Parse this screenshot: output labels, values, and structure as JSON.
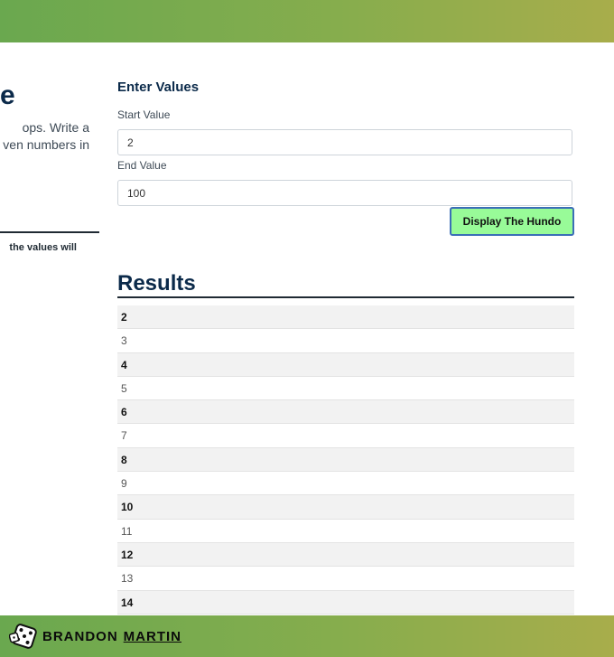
{
  "page": {
    "title_fragment": "e",
    "description_lines": [
      "ops. Write a",
      "ven numbers in"
    ],
    "note_fragment": "the values will"
  },
  "form": {
    "heading": "Enter Values",
    "start_label": "Start Value",
    "start_value": "2",
    "end_label": "End Value",
    "end_value": "100",
    "submit_label": "Display The Hundo"
  },
  "results": {
    "heading": "Results",
    "items": [
      "2",
      "3",
      "4",
      "5",
      "6",
      "7",
      "8",
      "9",
      "10",
      "11",
      "12",
      "13",
      "14"
    ]
  },
  "footer": {
    "logo_icon": "dice-icon",
    "brand_first": "BRANDON",
    "brand_last": "MARTIN"
  },
  "colors": {
    "bar_gradient_start": "#6aa84f",
    "bar_gradient_end": "#a8ad4b",
    "button_bg": "#98fb98",
    "button_border": "#3b6fb6",
    "heading": "#0b2a4a",
    "even_row_bg": "#f2f2f2"
  }
}
